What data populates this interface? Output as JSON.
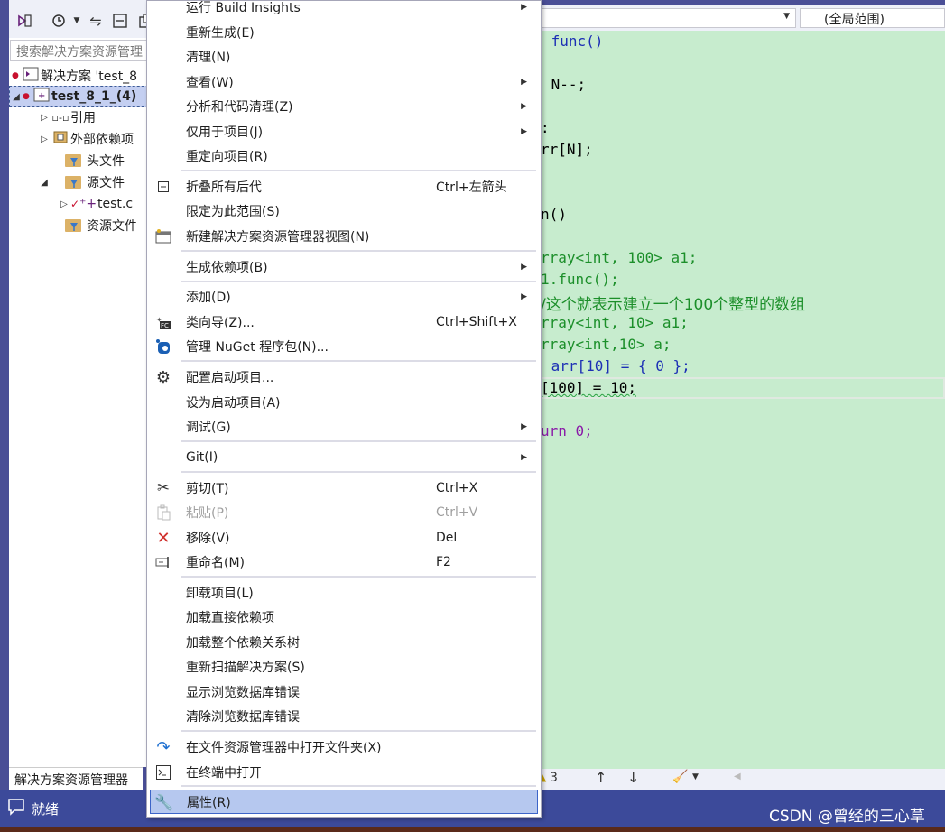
{
  "solution_explorer": {
    "search_placeholder": "搜索解决方案资源管理",
    "tab_label": "解决方案资源管理器",
    "tree": {
      "solution_label": "解决方案 'test_8",
      "project_label": "test_8_1_(4)",
      "references": "引用",
      "external_deps": "外部依赖项",
      "header_files": "头文件",
      "source_files": "源文件",
      "test_file": "test.c",
      "resource_files": "资源文件"
    }
  },
  "editor": {
    "scope_dropdown": "(全局范围)",
    "code_lines": [
      {
        "text": " func()",
        "style": "plain"
      },
      {
        "text": " N--;",
        "style": "plain"
      },
      {
        "text": ":",
        "style": "plain"
      },
      {
        "text": "rr[N];",
        "style": "plain"
      },
      {
        "text": "n()",
        "style": "plain"
      },
      {
        "text": "rray<int, 100> a1;",
        "style": "cm"
      },
      {
        "text": "1.func();",
        "style": "cm"
      },
      {
        "text": "/这个就表示建立一个100个整型的数组",
        "style": "cm"
      },
      {
        "text": "rray<int, 10> a1;",
        "style": "cm"
      },
      {
        "text": "rray<int,10> a;",
        "style": "cm"
      },
      {
        "text": " arr[10] = { 0 };",
        "style": "plain"
      },
      {
        "text": "[100] = 10;",
        "style": "plain"
      },
      {
        "text": "urn 0;",
        "style": "plain"
      }
    ],
    "status_count": "3"
  },
  "context_menu": {
    "items": [
      {
        "label": "运行 Build Insights",
        "submenu": true
      },
      {
        "label": "重新生成(E)"
      },
      {
        "label": "清理(N)"
      },
      {
        "label": "查看(W)",
        "submenu": true
      },
      {
        "label": "分析和代码清理(Z)",
        "submenu": true
      },
      {
        "label": "仅用于项目(J)",
        "submenu": true
      },
      {
        "label": "重定向项目(R)"
      },
      {
        "label": "折叠所有后代",
        "shortcut": "Ctrl+左箭头",
        "icon": "collapse-icon"
      },
      {
        "label": "限定为此范围(S)"
      },
      {
        "label": "新建解决方案资源管理器视图(N)",
        "icon": "new-view-icon"
      },
      {
        "label": "生成依赖项(B)",
        "submenu": true
      },
      {
        "label": "添加(D)",
        "submenu": true
      },
      {
        "label": "类向导(Z)...",
        "shortcut": "Ctrl+Shift+X",
        "icon": "class-wizard-icon"
      },
      {
        "label": "管理 NuGet 程序包(N)...",
        "icon": "nuget-icon"
      },
      {
        "label": "配置启动项目...",
        "icon": "gear-icon"
      },
      {
        "label": "设为启动项目(A)"
      },
      {
        "label": "调试(G)",
        "submenu": true
      },
      {
        "label": "Git(I)",
        "submenu": true
      },
      {
        "label": "剪切(T)",
        "shortcut": "Ctrl+X",
        "icon": "scissors-icon"
      },
      {
        "label": "粘贴(P)",
        "shortcut": "Ctrl+V",
        "icon": "paste-icon",
        "disabled": true
      },
      {
        "label": "移除(V)",
        "shortcut": "Del",
        "icon": "remove-icon"
      },
      {
        "label": "重命名(M)",
        "shortcut": "F2",
        "icon": "rename-icon"
      },
      {
        "label": "卸载项目(L)"
      },
      {
        "label": "加载直接依赖项"
      },
      {
        "label": "加载整个依赖关系树"
      },
      {
        "label": "重新扫描解决方案(S)"
      },
      {
        "label": "显示浏览数据库错误"
      },
      {
        "label": "清除浏览数据库错误"
      },
      {
        "label": "在文件资源管理器中打开文件夹(X)",
        "icon": "open-folder-icon"
      },
      {
        "label": "在终端中打开",
        "icon": "terminal-icon"
      },
      {
        "label": "属性(R)",
        "icon": "wrench-icon",
        "highlighted": true
      }
    ]
  },
  "status_bar": {
    "text": "就绪"
  },
  "watermark": "CSDN @曾经的三心草",
  "colors": {
    "editor_bg": "#c7ecce",
    "status_bar": "#3c4a9a",
    "menu_highlight": "#b6c8ef",
    "comment_green": "#1c8f2a"
  }
}
